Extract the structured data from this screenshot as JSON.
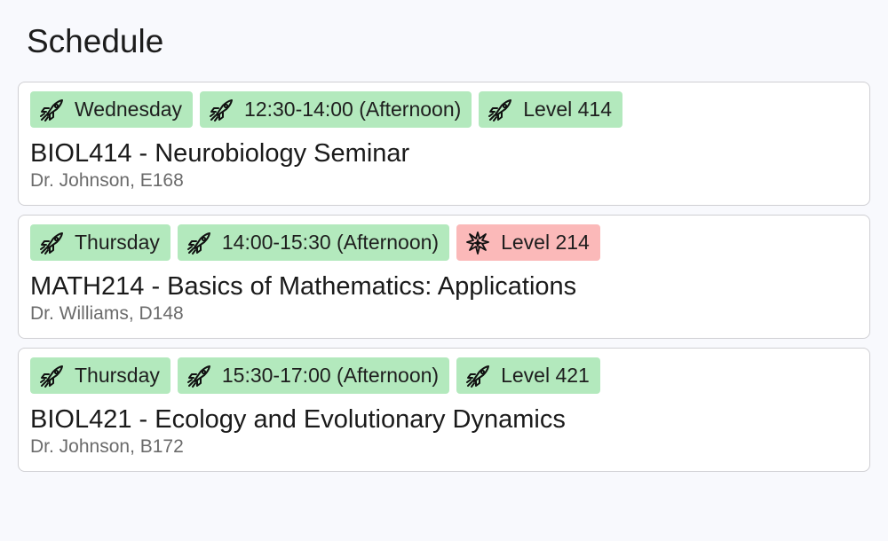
{
  "page": {
    "title": "Schedule"
  },
  "courses": [
    {
      "day": "Wednesday",
      "time": "12:30-14:00 (Afternoon)",
      "level": "Level 414",
      "title": "BIOL414 - Neurobiology Seminar",
      "meta": "Dr. Johnson, E168",
      "icons": {
        "day": "rocket-icon",
        "time": "rocket-icon",
        "level": "rocket-icon"
      },
      "status": {
        "day": "ok",
        "time": "ok",
        "level": "ok"
      }
    },
    {
      "day": "Thursday",
      "time": "14:00-15:30 (Afternoon)",
      "level": "Level 214",
      "title": "MATH214 - Basics of Mathematics: Applications",
      "meta": "Dr. Williams, D148",
      "icons": {
        "day": "rocket-icon",
        "time": "rocket-icon",
        "level": "collision-icon"
      },
      "status": {
        "day": "ok",
        "time": "ok",
        "level": "warn"
      }
    },
    {
      "day": "Thursday",
      "time": "15:30-17:00 (Afternoon)",
      "level": "Level 421",
      "title": "BIOL421 - Ecology and Evolutionary Dynamics",
      "meta": "Dr. Johnson, B172",
      "icons": {
        "day": "rocket-icon",
        "time": "rocket-icon",
        "level": "rocket-icon"
      },
      "status": {
        "day": "ok",
        "time": "ok",
        "level": "ok"
      }
    }
  ],
  "colors": {
    "ok_tag": "#b3e9bd",
    "warn_tag": "#fbb9b9",
    "background": "#f8f9fd",
    "card_border": "#cfcfd3"
  }
}
